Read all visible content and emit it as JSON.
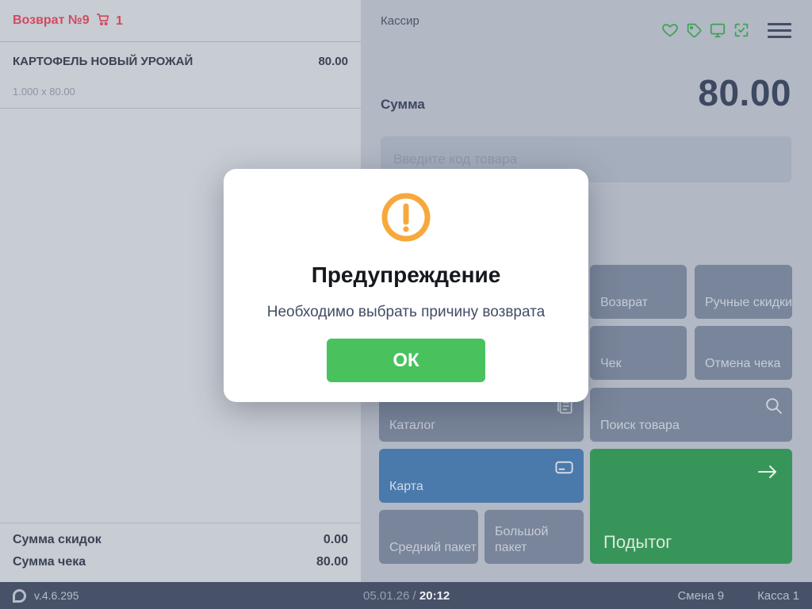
{
  "colors": {
    "left_bg": "#c8ccd3",
    "right_bg": "#b2b8c4",
    "accent_red": "#d04a60",
    "dark_text": "#3a4254",
    "button_gray": "#79859a",
    "button_blue": "#4a7aab",
    "button_green_dark": "#38955a",
    "button_green_bright": "#49c25e",
    "warning_orange": "#f7a83d",
    "statusbar_bg": "#475269",
    "icon_green": "#3da254"
  },
  "left_panel": {
    "header": {
      "title": "Возврат №9",
      "cart_count": "1"
    },
    "item": {
      "name": "КАРТОФЕЛЬ НОВЫЙ УРОЖАЙ",
      "price": "80.00",
      "qty_line": "1.000 x 80.00"
    },
    "summary": [
      {
        "label": "Сумма скидок",
        "value": "0.00"
      },
      {
        "label": "Сумма чека",
        "value": "80.00"
      }
    ]
  },
  "right_panel": {
    "cashier_label": "Кассир",
    "sum_label": "Сумма",
    "sum_value": "80.00",
    "input_placeholder": "Введите код товара",
    "icons": [
      "heart-icon",
      "tag-icon",
      "monitor-icon",
      "scan-check-icon",
      "menu-icon"
    ],
    "buttons": {
      "vozvrat": "Возврат",
      "manual_discounts": "Ручные скидки",
      "check": "Чек",
      "cancel_check": "Отмена чека",
      "catalog": "Каталог",
      "search_product": "Поиск товара",
      "card": "Карта",
      "medium_bag": "Средний пакет",
      "big_bag": "Большой пакет",
      "subtotal": "Подытог"
    }
  },
  "modal": {
    "title": "Предупреждение",
    "message": "Необходимо выбрать причину возврата",
    "ok_label": "ОК"
  },
  "status_bar": {
    "version": "v.4.6.295",
    "date": "05.01.26",
    "separator": " / ",
    "time": "20:12",
    "shift": "Смена 9",
    "register": "Касса 1"
  }
}
